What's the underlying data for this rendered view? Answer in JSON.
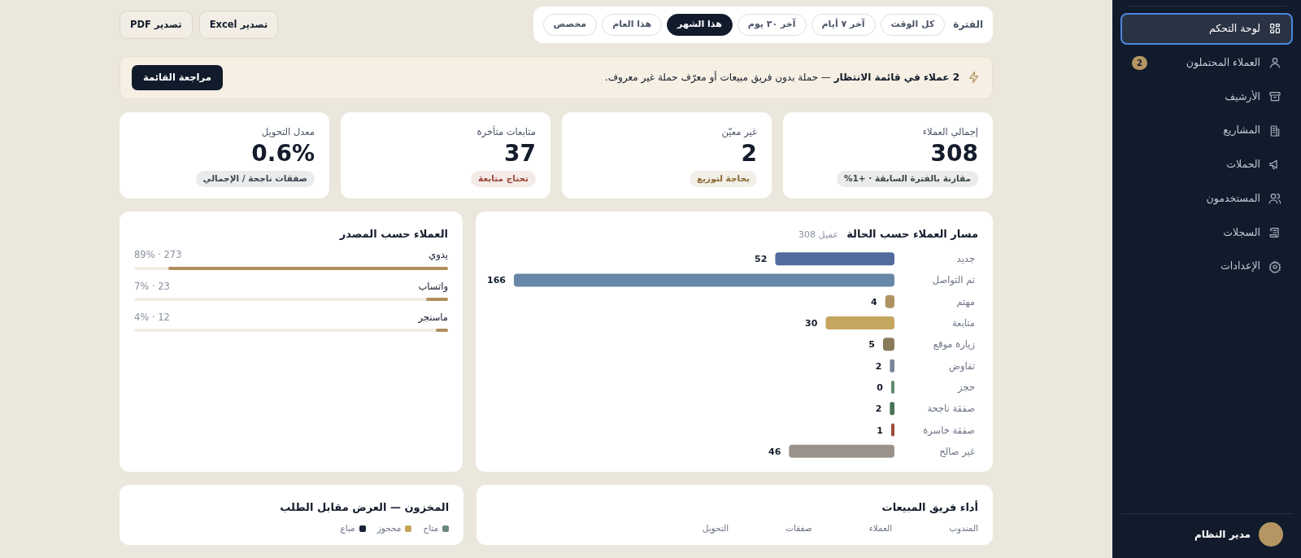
{
  "sidebar": {
    "items": [
      {
        "label": "لوحة التحكم",
        "selected": true
      },
      {
        "label": "العملاء المحتملون",
        "selected": false,
        "badge": "2"
      },
      {
        "label": "الأرشيف",
        "selected": false
      },
      {
        "label": "المشاريع",
        "selected": false
      },
      {
        "label": "الحملات",
        "selected": false
      },
      {
        "label": "المستخدمون",
        "selected": false
      },
      {
        "label": "السجلات",
        "selected": false
      },
      {
        "label": "الإعدادات",
        "selected": false
      }
    ],
    "user": {
      "name": "مدير النظام"
    }
  },
  "toolbar": {
    "period_label": "الفترة",
    "periods": [
      {
        "label": "كل الوقت",
        "selected": false
      },
      {
        "label": "آخر ٧ أيام",
        "selected": false
      },
      {
        "label": "آخر ٣٠ يوم",
        "selected": false
      },
      {
        "label": "هذا الشهر",
        "selected": true
      },
      {
        "label": "هذا العام",
        "selected": false
      },
      {
        "label": "مخصص",
        "selected": false
      }
    ],
    "export_buttons": [
      "تصدير Excel",
      "تصدير PDF"
    ]
  },
  "alert": {
    "text": "**2 عملاء في قائمة الانتظار** — حملة بدون فريق مبيعات أو معرّف حملة غير معروف.",
    "button": "مراجعة القائمة"
  },
  "stats": [
    {
      "label": "إجمالي العملاء",
      "value": "308",
      "note": "مقارنة بالفترة السابقة · +1%",
      "color": "#3e4a44"
    },
    {
      "label": "غير معيّن",
      "value": "2",
      "note": "بحاجة لتوزيع",
      "color": "#8a6a33"
    },
    {
      "label": "متابعات متأخرة",
      "value": "37",
      "note": "تحتاج متابعة",
      "color": "#9b4536"
    },
    {
      "label": "معدل التحويل",
      "value": "0.6%",
      "note": "صفقات ناجحة / الإجمالي",
      "color": "#3f4550"
    }
  ],
  "funnel": {
    "title": "مسار العملاء حسب الحالة",
    "count": "308 عميل",
    "chart_data": {
      "type": "bar",
      "orientation": "horizontal",
      "data_labels": true,
      "categories": [
        "جديد",
        "تم التواصل",
        "مهتم",
        "متابعة",
        "زيارة موقع",
        "تفاوض",
        "حجز",
        "صفقة ناجحة",
        "صفقة خاسرة",
        "غير صالح"
      ],
      "values": [
        52,
        166,
        4,
        30,
        5,
        2,
        0,
        2,
        1,
        46
      ],
      "colors": [
        "#526c9f",
        "#6787a8",
        "#b09262",
        "#c6a55f",
        "#8a7a5c",
        "#7a8599",
        "#5f8a6c",
        "#4a7256",
        "#9c4a3a",
        "#9a928a"
      ]
    }
  },
  "sources": {
    "title": "العملاء حسب المصدر",
    "items": [
      {
        "label": "يدوي",
        "reading": "273 · 89%",
        "level": 0.89
      },
      {
        "label": "واتساب",
        "reading": "23 · 7%",
        "level": 0.07
      },
      {
        "label": "ماسنجر",
        "reading": "12 · 4%",
        "level": 0.04
      }
    ]
  },
  "sales_team": {
    "title": "أداء فريق المبيعات",
    "columns": [
      "المندوب",
      "العملاء",
      "صفقات",
      "التحويل"
    ]
  },
  "inventory": {
    "title": "المخزون — العرض مقابل الطلب",
    "legend": [
      {
        "label": "متاح",
        "color": "#6b8a7a"
      },
      {
        "label": "محجوز",
        "color": "#c9a55a"
      },
      {
        "label": "مباع",
        "color": "#1a2236"
      }
    ]
  }
}
